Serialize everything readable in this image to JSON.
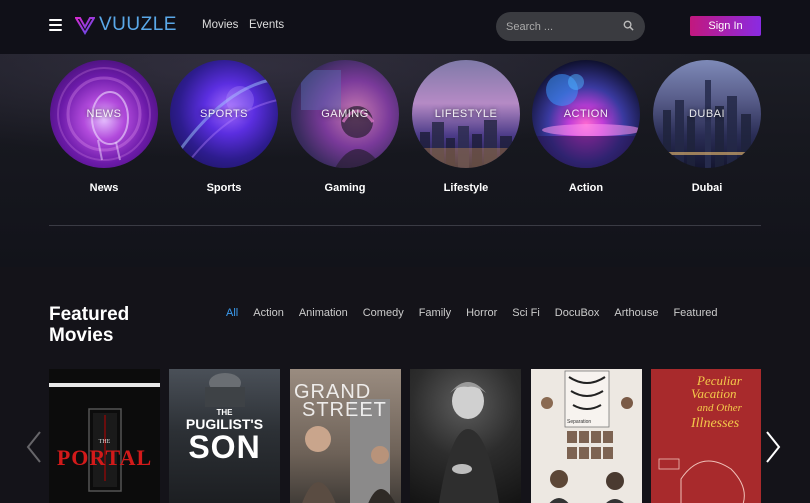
{
  "nav": {
    "logo_text": "VUUZLE",
    "links": [
      "Movies",
      "Events"
    ],
    "search_placeholder": "Search ...",
    "signin_label": "Sign In"
  },
  "categories": [
    {
      "label": "News",
      "overlay": "NEWS"
    },
    {
      "label": "Sports",
      "overlay": "SPORTS"
    },
    {
      "label": "Gaming",
      "overlay": "GAMING"
    },
    {
      "label": "Lifestyle",
      "overlay": "LIFESTYLE"
    },
    {
      "label": "Action",
      "overlay": "ACTION"
    },
    {
      "label": "Dubai",
      "overlay": "DUBAI"
    }
  ],
  "featured": {
    "title_line1": "Featured",
    "title_line2": "Movies",
    "filters": [
      "All",
      "Action",
      "Animation",
      "Comedy",
      "Family",
      "Horror",
      "Sci Fi",
      "DocuBox",
      "Arthouse",
      "Featured"
    ],
    "active_filter": "All",
    "posters": [
      {
        "title_small": "THE",
        "title": "PORTAL"
      },
      {
        "title_small": "THE",
        "title": "PUGILIST'S",
        "title2": "SON"
      },
      {
        "title": "GRAND",
        "title2": "STREET"
      },
      {
        "title": ""
      },
      {
        "title": "Separation"
      },
      {
        "title": "Peculiar",
        "title2": "Vacation",
        "title3": "and Other",
        "title4": "Illnesses"
      }
    ]
  },
  "colors": {
    "accent_blue": "#3b9cf0",
    "signin_gradient_start": "#c2187e",
    "signin_gradient_end": "#8a2be2"
  }
}
